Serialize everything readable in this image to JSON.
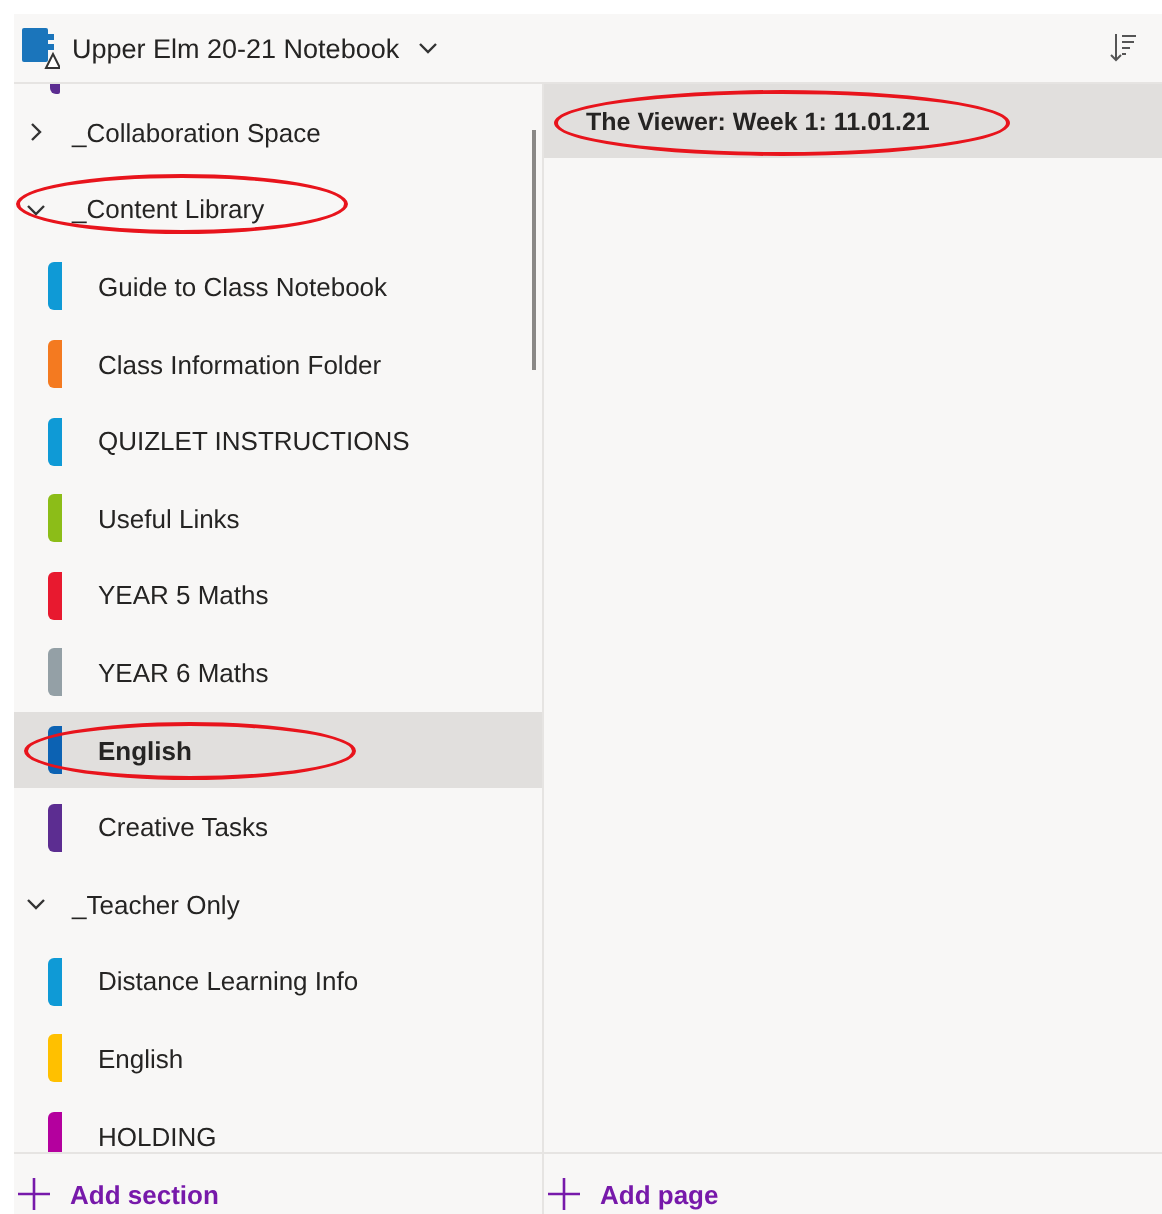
{
  "notebook": {
    "title": "Upper Elm 20-21 Notebook"
  },
  "section_groups": [
    {
      "label": "_Collaboration Space",
      "expanded": false,
      "circled": false
    },
    {
      "label": "_Content Library",
      "expanded": true,
      "circled": true,
      "sections": [
        {
          "label": "Guide to Class Notebook",
          "color": "#0f9ad6",
          "selected": false,
          "circled": false
        },
        {
          "label": "Class Information Folder",
          "color": "#f47a20",
          "selected": false,
          "circled": false
        },
        {
          "label": "QUIZLET INSTRUCTIONS",
          "color": "#0f9ad6",
          "selected": false,
          "circled": false
        },
        {
          "label": "Useful Links",
          "color": "#8cbd18",
          "selected": false,
          "circled": false
        },
        {
          "label": "YEAR 5 Maths",
          "color": "#e8192f",
          "selected": false,
          "circled": false
        },
        {
          "label": "YEAR 6 Maths",
          "color": "#94a0a6",
          "selected": false,
          "circled": false
        },
        {
          "label": "English",
          "color": "#0c62b3",
          "selected": true,
          "circled": true
        },
        {
          "label": "Creative Tasks",
          "color": "#5c2d91",
          "selected": false,
          "circled": false
        }
      ]
    },
    {
      "label": "_Teacher Only",
      "expanded": true,
      "circled": false,
      "sections": [
        {
          "label": "Distance Learning Info",
          "color": "#0f9ad6",
          "selected": false,
          "circled": false
        },
        {
          "label": "English",
          "color": "#ffc000",
          "selected": false,
          "circled": false
        },
        {
          "label": "HOLDING",
          "color": "#b4009e",
          "selected": false,
          "circled": false
        }
      ]
    }
  ],
  "pages": [
    {
      "label": "The Viewer: Week 1: 11.01.21",
      "selected": true,
      "circled": true
    }
  ],
  "add_section": "Add section",
  "add_page": "Add page"
}
